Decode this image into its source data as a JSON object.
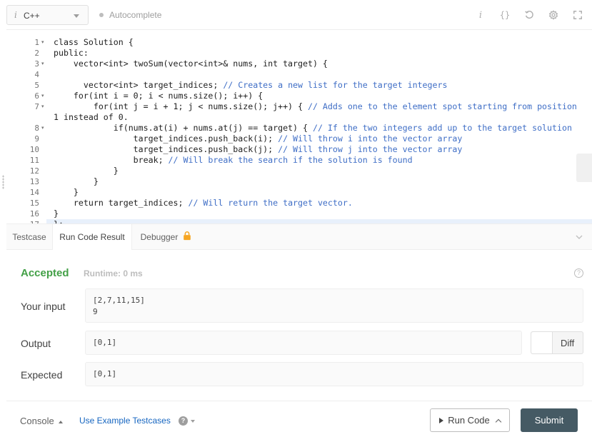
{
  "toolbar": {
    "info_glyph": "i",
    "language": "C++",
    "autocomplete_label": "Autocomplete",
    "icons": [
      "info-icon",
      "braces-icon",
      "reset-icon",
      "settings-icon",
      "fullscreen-icon"
    ],
    "icon_glyphs": {
      "info": "i",
      "braces": "{}"
    }
  },
  "editor": {
    "line_numbers": [
      "1",
      "2",
      "3",
      "4",
      "5",
      "6",
      "7",
      "",
      "8",
      "9",
      "10",
      "11",
      "12",
      "13",
      "14",
      "15",
      "16",
      "17"
    ],
    "lines": [
      "class Solution {",
      "public:",
      "    vector<int> twoSum(vector<int>& nums, int target) {",
      "",
      "      vector<int> target_indices; ",
      "    for(int i = 0; i < nums.size(); i++) {",
      "        for(int j = i + 1; j < nums.size(); j++) { ",
      "1 instead of 0.",
      "            if(nums.at(i) + nums.at(j) == target) { ",
      "                target_indices.push_back(i); ",
      "                target_indices.push_back(j); ",
      "                break; ",
      "            }",
      "        }",
      "    }",
      "    return target_indices; ",
      "}",
      "};"
    ],
    "comments": [
      "",
      "",
      "",
      "",
      "// Creates a new list for the target integers",
      "",
      "// Adds one to the element spot starting from position",
      "",
      "// If the two integers add up to the target solution",
      "// Will throw i into the vector array",
      "// Will throw j into the vector array",
      "// Will break the search if the solution is found",
      "",
      "",
      "",
      "// Will return the target vector.",
      "",
      ""
    ]
  },
  "panel": {
    "tabs": [
      {
        "label": "Testcase"
      },
      {
        "label": "Run Code Result"
      },
      {
        "label": "Debugger"
      }
    ],
    "active_tab": "Run Code Result"
  },
  "result": {
    "status": "Accepted",
    "runtime": "Runtime: 0 ms",
    "help_glyph": "?",
    "your_input_label": "Your input",
    "your_input_line1": "[2,7,11,15]",
    "your_input_line2": "9",
    "output_label": "Output",
    "output_value": "[0,1]",
    "expected_label": "Expected",
    "expected_value": "[0,1]",
    "diff_label": "Diff"
  },
  "footer": {
    "console_label": "Console",
    "example_testcases_label": "Use Example Testcases",
    "help_glyph": "?",
    "run_code_label": "Run Code",
    "submit_label": "Submit"
  },
  "colors": {
    "accepted": "#43a047",
    "submit_bg": "#455a64",
    "link": "#1565c0",
    "comment": "#3f6ec6",
    "keyword": "#1a3e9e",
    "lock": "#f6a623"
  }
}
